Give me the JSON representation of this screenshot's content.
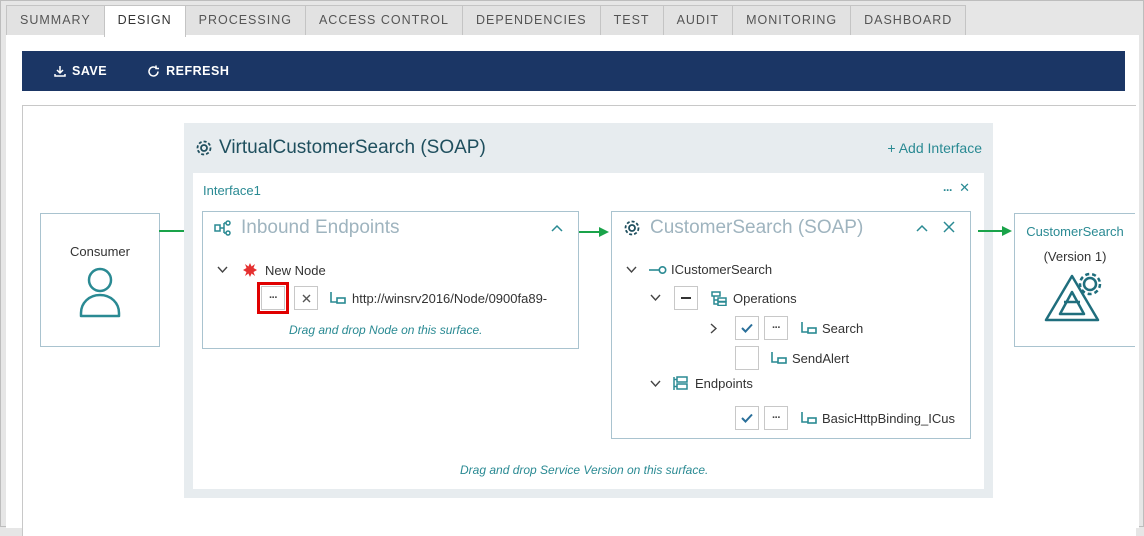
{
  "tabs": [
    "SUMMARY",
    "DESIGN",
    "PROCESSING",
    "ACCESS CONTROL",
    "DEPENDENCIES",
    "TEST",
    "AUDIT",
    "MONITORING",
    "DASHBOARD"
  ],
  "active_tab": "DESIGN",
  "toolbar": {
    "save_label": "SAVE",
    "refresh_label": "REFRESH"
  },
  "consumer": {
    "label": "Consumer"
  },
  "service": {
    "title": "VirtualCustomerSearch (SOAP)",
    "add_interface": "+ Add Interface"
  },
  "interface": {
    "title": "Interface1",
    "dots": "···",
    "close": "✕",
    "hint": "Drag and drop Service Version on this surface."
  },
  "inbound": {
    "title": "Inbound Endpoints",
    "node_label": "New Node",
    "node_url": "http://winsrv2016/Node/0900fa89-",
    "hint": "Drag and drop Node on this surface."
  },
  "customer_search": {
    "title": "CustomerSearch (SOAP)",
    "contract": "ICustomerSearch",
    "operations_label": "Operations",
    "operations": [
      "Search",
      "SendAlert"
    ],
    "endpoints_label": "Endpoints",
    "endpoints": [
      "BasicHttpBinding_ICus"
    ]
  },
  "version_box": {
    "title": "CustomerSearch",
    "subtitle": "(Version 1)"
  },
  "colors": {
    "toolbar": "#1b3665",
    "accent": "#2a8a93",
    "arrow": "#1aa34a",
    "highlight": "#e00000"
  },
  "icons": [
    "download-icon",
    "refresh-icon",
    "gear-icon",
    "user-icon",
    "bug-icon",
    "endpoint-icon",
    "interface-icon",
    "operations-icon",
    "endpoints-icon",
    "check-icon",
    "more-icon",
    "close-icon",
    "chevron-down-icon",
    "chevron-right-icon",
    "chevron-up-icon",
    "service-logo-icon"
  ]
}
